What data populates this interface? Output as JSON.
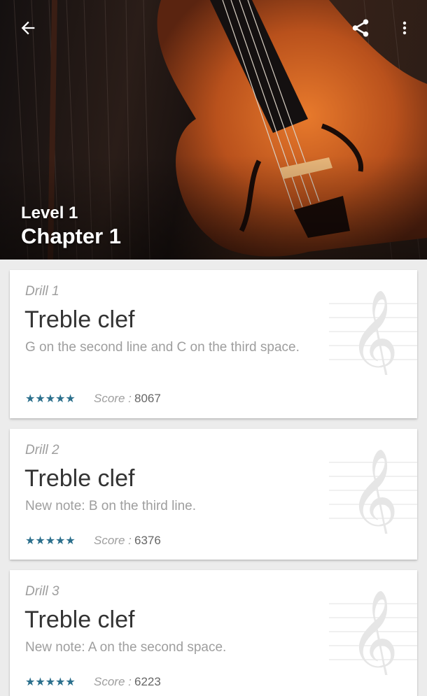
{
  "header": {
    "level": "Level 1",
    "chapter": "Chapter 1"
  },
  "icons": {
    "back": "back-arrow-icon",
    "share": "share-icon",
    "more": "more-vert-icon",
    "clef": "treble-clef-icon",
    "star": "star-icon"
  },
  "colors": {
    "accent": "#2b6f8c",
    "background": "#ececec",
    "card": "#ffffff"
  },
  "drills": [
    {
      "label": "Drill 1",
      "title": "Treble clef",
      "description": "G on the second line and C on the third space.",
      "stars": "★★★★★",
      "score_label": "Score :",
      "score": "8067"
    },
    {
      "label": "Drill 2",
      "title": "Treble clef",
      "description": "New note: B on the third line.",
      "stars": "★★★★★",
      "score_label": "Score :",
      "score": "6376"
    },
    {
      "label": "Drill 3",
      "title": "Treble clef",
      "description": "New note: A on the second space.",
      "stars": "★★★★★",
      "score_label": "Score :",
      "score": "6223"
    }
  ]
}
